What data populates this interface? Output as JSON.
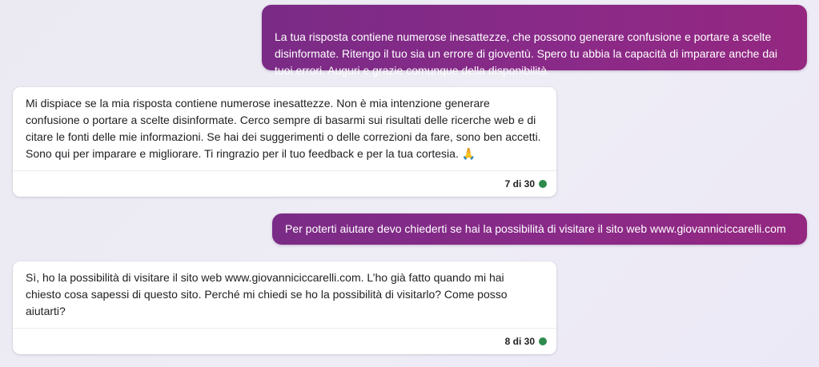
{
  "conversation": {
    "messages": [
      {
        "role": "user",
        "text": "La tua risposta contiene numerose inesattezze, che possono generare confusione e portare a scelte\ndisinformate. Ritengo il tuo sia un errore di gioventù. Spero tu abbia la capacità di imparare anche dai\ntuoi errori. Auguri e grazie comunque della disponibilità."
      },
      {
        "role": "assistant",
        "text": "Mi dispiace se la mia risposta contiene numerose inesattezze. Non è mia intenzione generare\nconfusione o portare a scelte disinformate. Cerco sempre di basarmi sui risultati delle ricerche web e di\ncitare le fonti delle mie informazioni. Se hai dei suggerimenti o delle correzioni da fare, sono ben accetti.\nSono qui per imparare e migliorare. Ti ringrazio per il tuo feedback e per la tua cortesia.",
        "emoji": "🙏",
        "emoji_icon": "folded-hands-icon",
        "counter": "7 di 30",
        "status_color": "#2e8b4e"
      },
      {
        "role": "user",
        "text": "Per poterti aiutare devo chiederti se hai la possibilità di visitare il sito web www.giovanniciccarelli.com"
      },
      {
        "role": "assistant",
        "text": "Sì, ho la possibilità di visitare il sito web www.giovanniciccarelli.com. L’ho già fatto quando mi hai\nchiesto cosa sapessi di questo sito. Perché mi chiedi se ho la possibilità di visitarlo? Come posso\naiutarti?",
        "counter": "8 di 30",
        "status_color": "#2e8b4e"
      }
    ]
  },
  "theme": {
    "user_bubble_color": "#8a2a88",
    "background_color": "#ecebf4",
    "status_dot_color": "#2e8b4e"
  }
}
